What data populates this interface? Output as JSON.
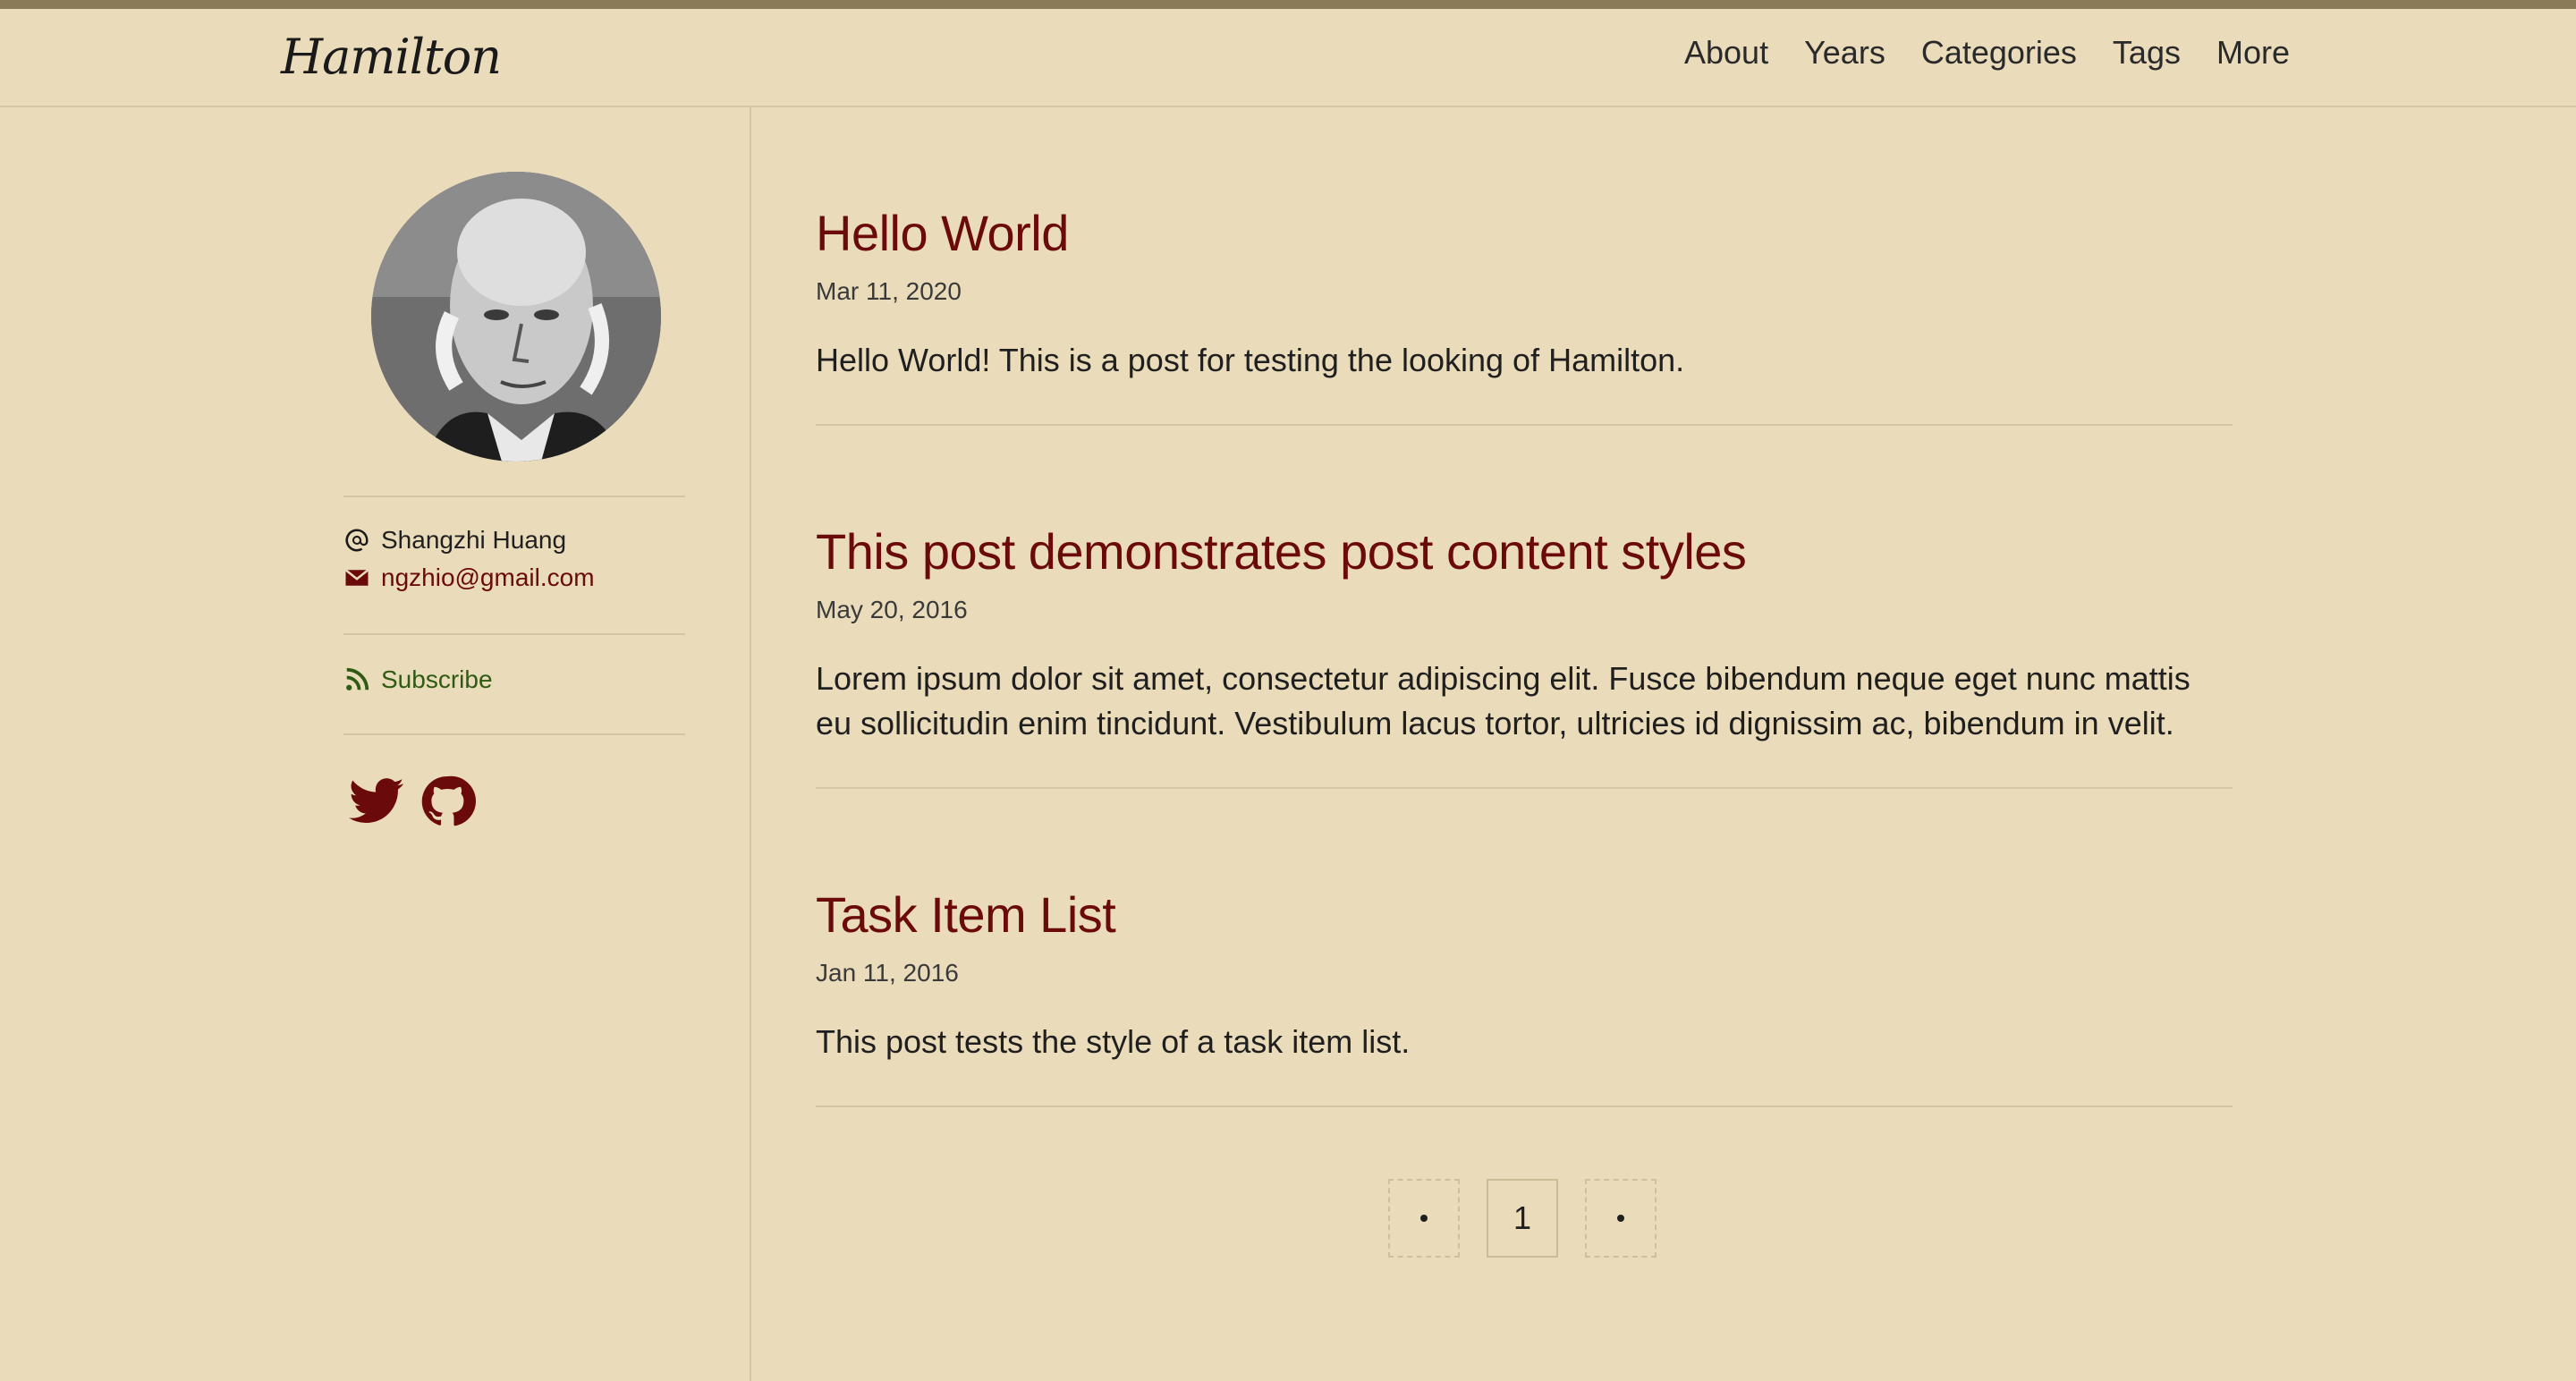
{
  "header": {
    "logo": "Hamilton",
    "nav": [
      "About",
      "Years",
      "Categories",
      "Tags",
      "More"
    ]
  },
  "sidebar": {
    "author_name": "Shangzhi Huang",
    "email": "ngzhio@gmail.com",
    "subscribe": "Subscribe",
    "social": [
      "twitter-icon",
      "github-icon"
    ]
  },
  "posts": [
    {
      "title": "Hello World",
      "date": "Mar 11, 2020",
      "excerpt": "Hello World! This is a post for testing the looking of Hamilton."
    },
    {
      "title": "This post demonstrates post content styles",
      "date": "May 20, 2016",
      "excerpt": "Lorem ipsum dolor sit amet, consectetur adipiscing elit. Fusce bibendum neque eget nunc mattis eu sollicitudin enim tincidunt. Vestibulum lacus tortor, ultricies id dignissim ac, bibendum in velit."
    },
    {
      "title": "Task Item List",
      "date": "Jan 11, 2016",
      "excerpt": "This post tests the style of a task item list."
    }
  ],
  "pagination": {
    "current": "1"
  },
  "colors": {
    "background": "#eadcbb",
    "accent": "#6b0a0a",
    "subscribe": "#2f5a12",
    "stripe": "#8a7a57"
  }
}
